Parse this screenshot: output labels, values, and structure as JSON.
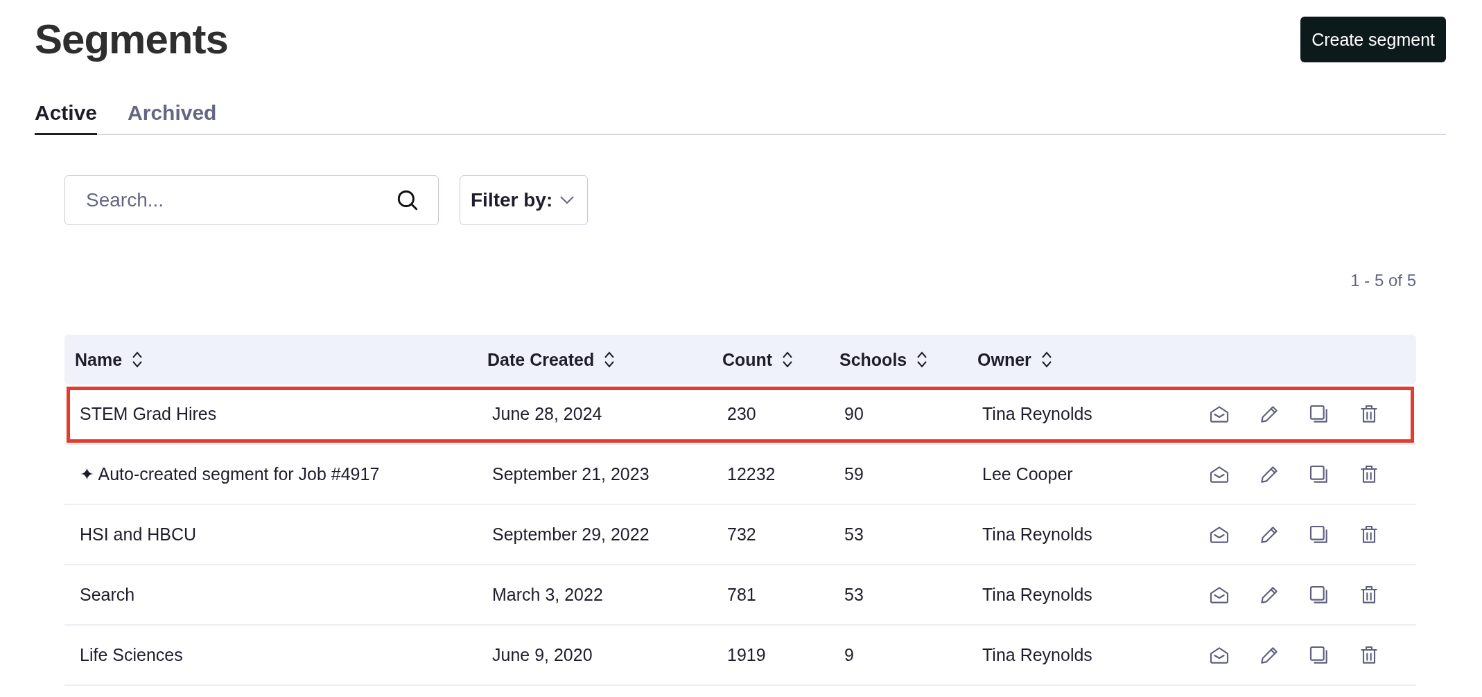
{
  "page": {
    "title": "Segments",
    "create_button": "Create segment"
  },
  "tabs": [
    {
      "label": "Active",
      "selected": true
    },
    {
      "label": "Archived",
      "selected": false
    }
  ],
  "search": {
    "placeholder": "Search..."
  },
  "filter": {
    "label": "Filter by:"
  },
  "pagination": "1 - 5 of 5",
  "table": {
    "columns": [
      "Name",
      "Date Created",
      "Count",
      "Schools",
      "Owner"
    ],
    "rows": [
      {
        "cells": [
          "STEM Grad Hires",
          "June 28, 2024",
          "230",
          "90",
          "Tina Reynolds"
        ],
        "highlighted": true
      },
      {
        "cells": [
          "✦ Auto-created segment for Job #4917",
          "September 21, 2023",
          "12232",
          "59",
          "Lee Cooper"
        ],
        "highlighted": false
      },
      {
        "cells": [
          "HSI and HBCU",
          "September 29, 2022",
          "732",
          "53",
          "Tina Reynolds"
        ],
        "highlighted": false
      },
      {
        "cells": [
          "Search",
          "March 3, 2022",
          "781",
          "53",
          "Tina Reynolds"
        ],
        "highlighted": false
      },
      {
        "cells": [
          "Life Sciences",
          "June 9, 2020",
          "1919",
          "9",
          "Tina Reynolds"
        ],
        "highlighted": false
      }
    ]
  }
}
